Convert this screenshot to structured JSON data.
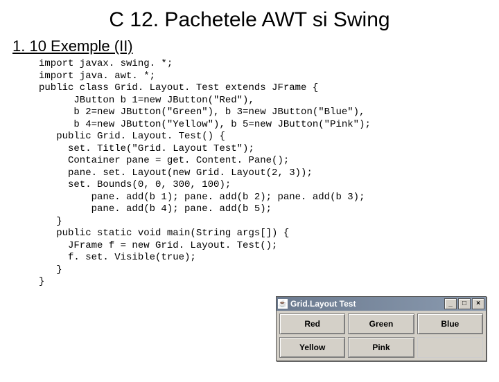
{
  "title": "C 12. Pachetele AWT si Swing",
  "subtitle": "1. 10 Exemple (II)",
  "code": "import javax. swing. *;\nimport java. awt. *;\npublic class Grid. Layout. Test extends JFrame {\n      JButton b 1=new JButton(\"Red\"),\n      b 2=new JButton(\"Green\"), b 3=new JButton(\"Blue\"),\n      b 4=new JButton(\"Yellow\"), b 5=new JButton(\"Pink\");\n   public Grid. Layout. Test() {\n     set. Title(\"Grid. Layout Test\");\n     Container pane = get. Content. Pane();\n     pane. set. Layout(new Grid. Layout(2, 3));\n     set. Bounds(0, 0, 300, 100);\n         pane. add(b 1); pane. add(b 2); pane. add(b 3);\n         pane. add(b 4); pane. add(b 5);\n   }\n   public static void main(String args[]) {\n     JFrame f = new Grid. Layout. Test();\n     f. set. Visible(true);\n   }\n}",
  "window": {
    "title": "Grid.Layout Test",
    "buttons": {
      "b1": "Red",
      "b2": "Green",
      "b3": "Blue",
      "b4": "Yellow",
      "b5": "Pink"
    },
    "controls": {
      "minimize": "_",
      "maximize": "□",
      "close": "×"
    }
  }
}
